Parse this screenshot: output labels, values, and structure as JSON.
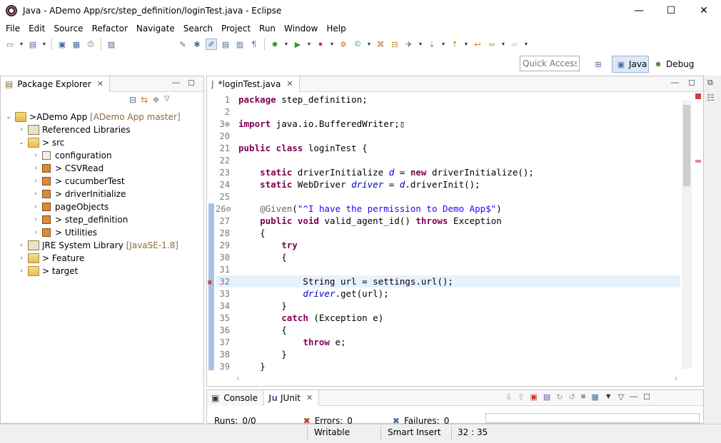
{
  "window": {
    "title": "Java - ADemo App/src/step_definition/loginTest.java - Eclipse",
    "minimize": "—",
    "maximize": "☐",
    "close": "✕"
  },
  "menu": [
    "File",
    "Edit",
    "Source",
    "Refactor",
    "Navigate",
    "Search",
    "Project",
    "Run",
    "Window",
    "Help"
  ],
  "toolbar": {
    "quick_access_placeholder": "Quick Access",
    "perspective_java": "Java",
    "perspective_debug": "Debug"
  },
  "package_explorer": {
    "tab_label": "Package Explorer",
    "project": {
      "prefix": "> ",
      "name": "ADemo App",
      "decoration": "[ADemo App master]"
    },
    "items": [
      {
        "label": "Referenced Libraries"
      },
      {
        "label": "> src"
      },
      {
        "label": "configuration"
      },
      {
        "label": "> CSVRead"
      },
      {
        "label": "> cucumberTest"
      },
      {
        "label": "> driverInitialize"
      },
      {
        "label": "pageObjects"
      },
      {
        "label": "> step_definition"
      },
      {
        "label": "> Utilities"
      },
      {
        "label": "JRE System Library",
        "decoration": "[JavaSE-1.8]"
      },
      {
        "label": "> Feature"
      },
      {
        "label": "> target"
      }
    ]
  },
  "editor": {
    "tab_label": "*loginTest.java",
    "lines": [
      {
        "n": "1",
        "seg": [
          {
            "c": "kw",
            "t": "package"
          },
          {
            "c": "",
            "t": " step_definition;"
          }
        ]
      },
      {
        "n": "2",
        "seg": []
      },
      {
        "n": "3⊕",
        "seg": [
          {
            "c": "kw",
            "t": "import"
          },
          {
            "c": "",
            "t": " java.io.BufferedWriter;▯"
          }
        ]
      },
      {
        "n": "20",
        "seg": []
      },
      {
        "n": "21",
        "seg": [
          {
            "c": "kw",
            "t": "public class"
          },
          {
            "c": "",
            "t": " loginTest {"
          }
        ]
      },
      {
        "n": "22",
        "seg": []
      },
      {
        "n": "23",
        "seg": [
          {
            "c": "",
            "t": "    "
          },
          {
            "c": "kw",
            "t": "static"
          },
          {
            "c": "",
            "t": " driverInitialize "
          },
          {
            "c": "fld",
            "t": "d"
          },
          {
            "c": "",
            "t": " = "
          },
          {
            "c": "kw",
            "t": "new"
          },
          {
            "c": "",
            "t": " driverInitialize();"
          }
        ]
      },
      {
        "n": "24",
        "seg": [
          {
            "c": "",
            "t": "    "
          },
          {
            "c": "kw",
            "t": "static"
          },
          {
            "c": "",
            "t": " WebDriver "
          },
          {
            "c": "fld",
            "t": "driver"
          },
          {
            "c": "",
            "t": " = "
          },
          {
            "c": "fld",
            "t": "d"
          },
          {
            "c": "",
            "t": ".driverInit();"
          }
        ]
      },
      {
        "n": "25",
        "seg": []
      },
      {
        "n": "26⊖",
        "seg": [
          {
            "c": "",
            "t": "    "
          },
          {
            "c": "ann",
            "t": "@Given"
          },
          {
            "c": "",
            "t": "("
          },
          {
            "c": "str",
            "t": "\"^I have the permission to Demo App$\""
          },
          {
            "c": "",
            "t": ")"
          }
        ]
      },
      {
        "n": "27",
        "seg": [
          {
            "c": "",
            "t": "    "
          },
          {
            "c": "kw",
            "t": "public void"
          },
          {
            "c": "",
            "t": " valid_agent_id() "
          },
          {
            "c": "kw",
            "t": "throws"
          },
          {
            "c": "",
            "t": " Exception"
          }
        ]
      },
      {
        "n": "28",
        "seg": [
          {
            "c": "",
            "t": "    {"
          }
        ]
      },
      {
        "n": "29",
        "seg": [
          {
            "c": "",
            "t": "        "
          },
          {
            "c": "kw",
            "t": "try"
          }
        ]
      },
      {
        "n": "30",
        "seg": [
          {
            "c": "",
            "t": "        {"
          }
        ]
      },
      {
        "n": "31",
        "seg": []
      },
      {
        "n": "32",
        "cur": true,
        "seg": [
          {
            "c": "",
            "t": "            String url = settings.url();"
          }
        ]
      },
      {
        "n": "33",
        "seg": [
          {
            "c": "",
            "t": "            "
          },
          {
            "c": "fld",
            "t": "driver"
          },
          {
            "c": "",
            "t": ".get(url);"
          }
        ]
      },
      {
        "n": "34",
        "seg": [
          {
            "c": "",
            "t": "        }"
          }
        ]
      },
      {
        "n": "35",
        "seg": [
          {
            "c": "",
            "t": "        "
          },
          {
            "c": "kw",
            "t": "catch"
          },
          {
            "c": "",
            "t": " (Exception e)"
          }
        ]
      },
      {
        "n": "36",
        "seg": [
          {
            "c": "",
            "t": "        {"
          }
        ]
      },
      {
        "n": "37",
        "seg": [
          {
            "c": "",
            "t": "            "
          },
          {
            "c": "kw",
            "t": "throw"
          },
          {
            "c": "",
            "t": " e;"
          }
        ]
      },
      {
        "n": "38",
        "seg": [
          {
            "c": "",
            "t": "        }"
          }
        ]
      },
      {
        "n": "39",
        "seg": [
          {
            "c": "",
            "t": "    }"
          }
        ]
      }
    ]
  },
  "bottom_panel": {
    "tab_console": "Console",
    "tab_junit": "JUnit",
    "runs_label": "Runs:",
    "runs_value": "0/0",
    "errors_label": "Errors:",
    "errors_value": "0",
    "failures_label": "Failures:",
    "failures_value": "0"
  },
  "status": {
    "writable": "Writable",
    "insert_mode": "Smart Insert",
    "position": "32 : 35"
  }
}
